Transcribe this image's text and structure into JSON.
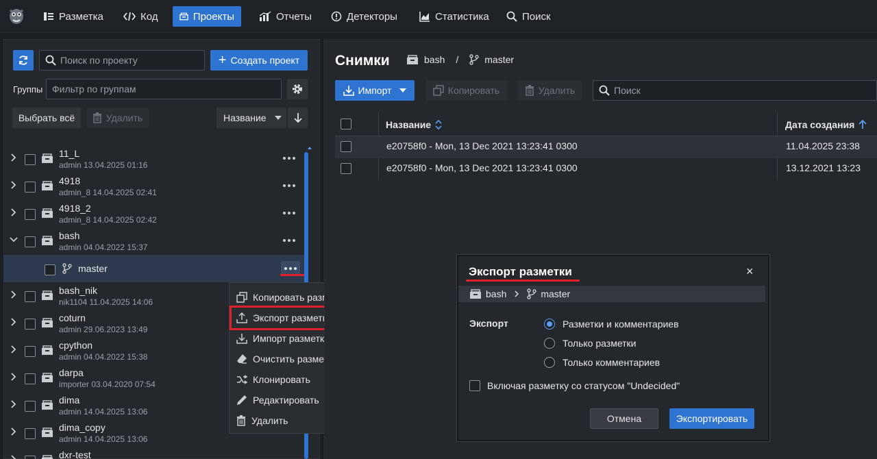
{
  "nav": {
    "items": [
      {
        "label": "Разметка",
        "icon": "markup-icon"
      },
      {
        "label": "Код",
        "icon": "code-icon"
      },
      {
        "label": "Проекты",
        "icon": "projects-icon"
      },
      {
        "label": "Отчеты",
        "icon": "reports-icon"
      },
      {
        "label": "Детекторы",
        "icon": "detectors-icon"
      },
      {
        "label": "Статистика",
        "icon": "statistics-icon"
      },
      {
        "label": "Поиск",
        "icon": "search-icon"
      }
    ],
    "active": "Проекты"
  },
  "left": {
    "search_placeholder": "Поиск по проекту",
    "create_label": "Создать проект",
    "groups_label": "Группы",
    "groups_placeholder": "Фильтр по группам",
    "select_all_label": "Выбрать всё",
    "delete_label": "Удалить",
    "sort_label": "Название",
    "tree": [
      {
        "name": "11_L",
        "sub": "admin 13.04.2025 01:16"
      },
      {
        "name": "4918",
        "sub": "admin_8 14.04.2025 02:41"
      },
      {
        "name": "4918_2",
        "sub": "admin_8 14.04.2025 02:42"
      },
      {
        "name": "bash",
        "sub": "admin 04.04.2022 15:37",
        "expanded": true
      },
      {
        "name": "master",
        "branch": true
      },
      {
        "name": "bash_nik",
        "sub": "nik1104 11.04.2025 14:06"
      },
      {
        "name": "coturn",
        "sub": "admin 29.06.2023 13:49"
      },
      {
        "name": "cpython",
        "sub": "admin 04.04.2022 15:38"
      },
      {
        "name": "darpa",
        "sub": "importer 03.04.2020 07:54"
      },
      {
        "name": "dima",
        "sub": "admin 14.04.2025 13:06"
      },
      {
        "name": "dima_copy",
        "sub": "admin 14.04.2025 13:06"
      },
      {
        "name": "dxr-test",
        "sub": ""
      }
    ]
  },
  "context_menu": {
    "items": [
      {
        "label": "Копировать разметку",
        "icon": "copy-icon"
      },
      {
        "label": "Экспорт разметки",
        "icon": "upload-icon"
      },
      {
        "label": "Импорт разметки",
        "icon": "download-icon"
      },
      {
        "label": "Очистить разметку",
        "icon": "eraser-icon"
      },
      {
        "label": "Клонировать",
        "icon": "clone-icon"
      },
      {
        "label": "Редактировать",
        "icon": "pencil-icon"
      },
      {
        "label": "Удалить",
        "icon": "trash-icon"
      }
    ]
  },
  "right": {
    "title": "Снимки",
    "crumb_project": "bash",
    "crumb_sep": "/",
    "crumb_branch": "master",
    "import_label": "Импорт",
    "copy_label": "Копировать",
    "delete_label": "Удалить",
    "search_placeholder": "Поиск",
    "col_name": "Название",
    "col_date": "Дата создания",
    "rows": [
      {
        "name": "e20758f0 - Mon, 13 Dec 2021 13:23:41 0300",
        "date": "11.04.2025 23:38"
      },
      {
        "name": "e20758f0 - Mon, 13 Dec 2021 13:23:41 0300",
        "date": "13.12.2021 13:23"
      }
    ]
  },
  "dialog": {
    "title": "Экспорт разметки",
    "project": "bash",
    "branch": "master",
    "close": "×",
    "export_label": "Экспорт",
    "options": [
      "Разметки и комментариев",
      "Только разметки",
      "Только комментариев"
    ],
    "selected": 0,
    "include_undecided": "Включая разметку со статусом \"Undecided\"",
    "cancel_label": "Отмена",
    "export_button": "Экспортировать"
  },
  "colors": {
    "accent": "#2f73d1",
    "highlight": "#e3202a"
  }
}
